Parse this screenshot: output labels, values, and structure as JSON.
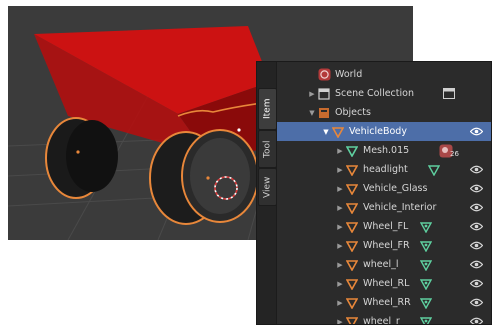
{
  "side_tabs": [
    "Item",
    "Tool",
    "View"
  ],
  "outliner": {
    "world": "World",
    "scene_collection": "Scene Collection",
    "objects": "Objects",
    "selected": "VehicleBody",
    "mesh": "Mesh.015",
    "mesh_users": "26",
    "children": [
      "headlight",
      "Vehicle_Glass",
      "Vehicle_Interior",
      "Wheel_FL",
      "Wheel_FR",
      "wheel_l",
      "Wheel_RL",
      "Wheel_RR",
      "wheel_r"
    ]
  },
  "colors": {
    "selection": "#4d6ea8",
    "object_orange": "#e8873a",
    "mesh_green": "#5fd0a0",
    "car_body_red": "#cc1111",
    "viewport_bg": "#3b3b3b"
  },
  "icons": [
    "world-icon",
    "collection-icon",
    "object-icon",
    "mesh-icon",
    "eye-icon",
    "modifier-icon"
  ]
}
